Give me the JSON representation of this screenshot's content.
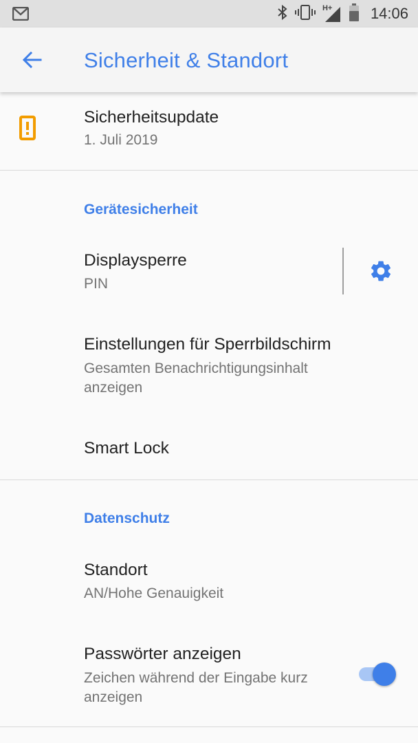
{
  "status_bar": {
    "time": "14:06",
    "network_label": "H+",
    "icons": [
      "gmail-icon",
      "bluetooth-icon",
      "vibrate-icon",
      "signal-icon",
      "battery-icon"
    ]
  },
  "app_bar": {
    "title": "Sicherheit & Standort",
    "back_icon": "arrow-back-icon"
  },
  "security_update": {
    "title": "Sicherheitsupdate",
    "date": "1. Juli 2019",
    "icon": "warning-icon"
  },
  "device_security": {
    "header": "Gerätesicherheit",
    "items": [
      {
        "title": "Displaysperre",
        "subtitle": "PIN",
        "action_icon": "gear-icon"
      },
      {
        "title": "Einstellungen für Sperrbildschirm",
        "subtitle": "Gesamten Benachrichtigungsinhalt anzeigen"
      },
      {
        "title": "Smart Lock"
      }
    ]
  },
  "privacy": {
    "header": "Datenschutz",
    "items": [
      {
        "title": "Standort",
        "subtitle": "AN/Hohe Genauigkeit"
      },
      {
        "title": "Passwörter anzeigen",
        "subtitle": "Zeichen während der Eingabe kurz anzeigen",
        "toggle_on": true
      }
    ]
  },
  "colors": {
    "accent": "#3f7fe8",
    "warning": "#f29c00",
    "status_bar_bg": "#e0e0e0",
    "background": "#fafafa"
  }
}
